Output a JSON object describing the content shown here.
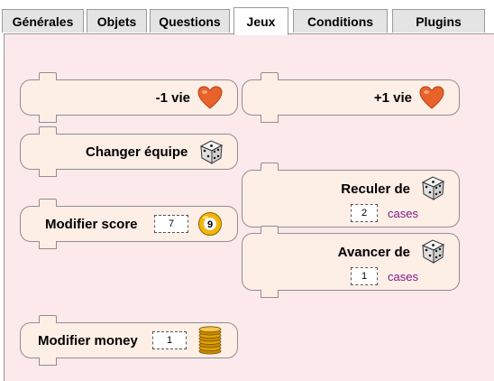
{
  "tabs": [
    {
      "label": "Générales",
      "active": false
    },
    {
      "label": "Objets",
      "active": false
    },
    {
      "label": "Questions",
      "active": false
    },
    {
      "label": "Jeux",
      "active": true
    },
    {
      "label": "Conditions",
      "active": false
    },
    {
      "label": "Plugins",
      "active": false
    }
  ],
  "blocks": {
    "lose_life": {
      "label": "-1 vie",
      "icon": "heart-icon"
    },
    "gain_life": {
      "label": "+1 vie",
      "icon": "heart-icon"
    },
    "change_team": {
      "label": "Changer équipe",
      "icon": "dice-icon"
    },
    "move_back": {
      "label": "Reculer de",
      "value": "2",
      "unit": "cases",
      "icon": "dice-icon"
    },
    "modify_score": {
      "label": "Modifier score",
      "value": "7",
      "icon": "billiard-ball-icon",
      "ball_number": "9"
    },
    "move_forward": {
      "label": "Avancer de",
      "value": "1",
      "unit": "cases",
      "icon": "dice-icon"
    },
    "modify_money": {
      "label": "Modifier money",
      "value": "1",
      "icon": "coins-icon"
    }
  },
  "colors": {
    "panel_bg": "#fce9ec",
    "block_bg": "#fdeee6",
    "heart": "#e8622a",
    "unit_text": "#7a1c8c"
  }
}
